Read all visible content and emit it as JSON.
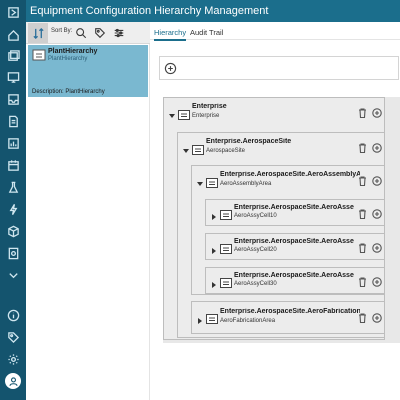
{
  "app": {
    "title": "Equipment Configuration Hierarchy Management"
  },
  "rail": {
    "icons": [
      "home-icon",
      "layers-icon",
      "monitor-icon",
      "inbox-icon",
      "document-icon",
      "report-icon",
      "calendar-icon",
      "flask-icon",
      "bolt-icon",
      "cube-icon",
      "gear-doc-icon",
      "chevron-down-icon",
      "info-icon",
      "tag-icon",
      "settings-icon",
      "user-icon"
    ]
  },
  "left_panel": {
    "sort_label": "Sort By:",
    "item": {
      "name": "PlantHierarchy",
      "subtitle": "PlantHierarchy",
      "description": "Description: PlantHierarchy"
    }
  },
  "tabs": [
    {
      "label": "Hierarchy",
      "active": true
    },
    {
      "label": "Audit Trail",
      "active": false
    }
  ],
  "tree": {
    "nodes": [
      {
        "name": "Enterprise",
        "sub": "Enterprise"
      },
      {
        "name": "Enterprise.AerospaceSite",
        "sub": "AerospaceSite"
      },
      {
        "name": "Enterprise.AerospaceSite.AeroAssemblyArea",
        "sub": "AeroAssemblyArea"
      },
      {
        "name": "Enterprise.AerospaceSite.AeroAssembl...",
        "sub": "AeroAssyCell10"
      },
      {
        "name": "Enterprise.AerospaceSite.AeroAssembl...",
        "sub": "AeroAssyCell20"
      },
      {
        "name": "Enterprise.AerospaceSite.AeroAssembl...",
        "sub": "AeroAssyCell30"
      },
      {
        "name": "Enterprise.AerospaceSite.AeroFabricationArea",
        "sub": "AeroFabricationArea"
      }
    ]
  }
}
